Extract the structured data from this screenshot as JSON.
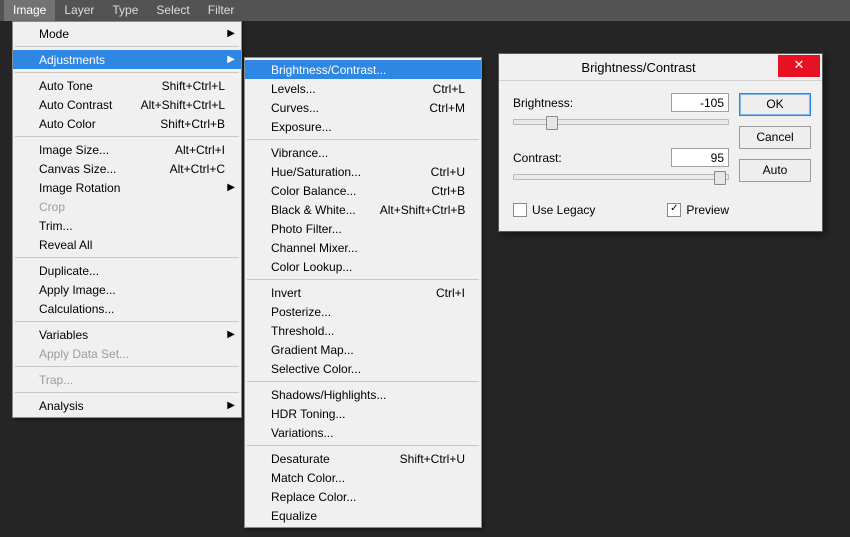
{
  "menubar": {
    "items": [
      {
        "label": "Image",
        "active": true
      },
      {
        "label": "Layer"
      },
      {
        "label": "Type"
      },
      {
        "label": "Select"
      },
      {
        "label": "Filter"
      }
    ]
  },
  "imageMenu": {
    "groups": [
      [
        {
          "label": "Mode",
          "submenu": true
        }
      ],
      [
        {
          "label": "Adjustments",
          "submenu": true,
          "highlight": true
        }
      ],
      [
        {
          "label": "Auto Tone",
          "shortcut": "Shift+Ctrl+L"
        },
        {
          "label": "Auto Contrast",
          "shortcut": "Alt+Shift+Ctrl+L"
        },
        {
          "label": "Auto Color",
          "shortcut": "Shift+Ctrl+B"
        }
      ],
      [
        {
          "label": "Image Size...",
          "shortcut": "Alt+Ctrl+I"
        },
        {
          "label": "Canvas Size...",
          "shortcut": "Alt+Ctrl+C"
        },
        {
          "label": "Image Rotation",
          "submenu": true
        },
        {
          "label": "Crop",
          "disabled": true
        },
        {
          "label": "Trim..."
        },
        {
          "label": "Reveal All"
        }
      ],
      [
        {
          "label": "Duplicate..."
        },
        {
          "label": "Apply Image..."
        },
        {
          "label": "Calculations..."
        }
      ],
      [
        {
          "label": "Variables",
          "submenu": true
        },
        {
          "label": "Apply Data Set...",
          "disabled": true
        }
      ],
      [
        {
          "label": "Trap...",
          "disabled": true
        }
      ],
      [
        {
          "label": "Analysis",
          "submenu": true
        }
      ]
    ]
  },
  "adjustmentsMenu": {
    "groups": [
      [
        {
          "label": "Brightness/Contrast...",
          "highlight": true
        },
        {
          "label": "Levels...",
          "shortcut": "Ctrl+L"
        },
        {
          "label": "Curves...",
          "shortcut": "Ctrl+M"
        },
        {
          "label": "Exposure..."
        }
      ],
      [
        {
          "label": "Vibrance..."
        },
        {
          "label": "Hue/Saturation...",
          "shortcut": "Ctrl+U"
        },
        {
          "label": "Color Balance...",
          "shortcut": "Ctrl+B"
        },
        {
          "label": "Black & White...",
          "shortcut": "Alt+Shift+Ctrl+B"
        },
        {
          "label": "Photo Filter..."
        },
        {
          "label": "Channel Mixer..."
        },
        {
          "label": "Color Lookup..."
        }
      ],
      [
        {
          "label": "Invert",
          "shortcut": "Ctrl+I"
        },
        {
          "label": "Posterize..."
        },
        {
          "label": "Threshold..."
        },
        {
          "label": "Gradient Map..."
        },
        {
          "label": "Selective Color..."
        }
      ],
      [
        {
          "label": "Shadows/Highlights..."
        },
        {
          "label": "HDR Toning..."
        },
        {
          "label": "Variations..."
        }
      ],
      [
        {
          "label": "Desaturate",
          "shortcut": "Shift+Ctrl+U"
        },
        {
          "label": "Match Color..."
        },
        {
          "label": "Replace Color..."
        },
        {
          "label": "Equalize"
        }
      ]
    ]
  },
  "dialog": {
    "title": "Brightness/Contrast",
    "brightness": {
      "label": "Brightness:",
      "value": "-105",
      "thumbPct": 18
    },
    "contrast": {
      "label": "Contrast:",
      "value": "95",
      "thumbPct": 96
    },
    "useLegacy": {
      "label": "Use Legacy",
      "checked": false
    },
    "preview": {
      "label": "Preview",
      "checked": true
    },
    "buttons": {
      "ok": "OK",
      "cancel": "Cancel",
      "auto": "Auto"
    }
  }
}
